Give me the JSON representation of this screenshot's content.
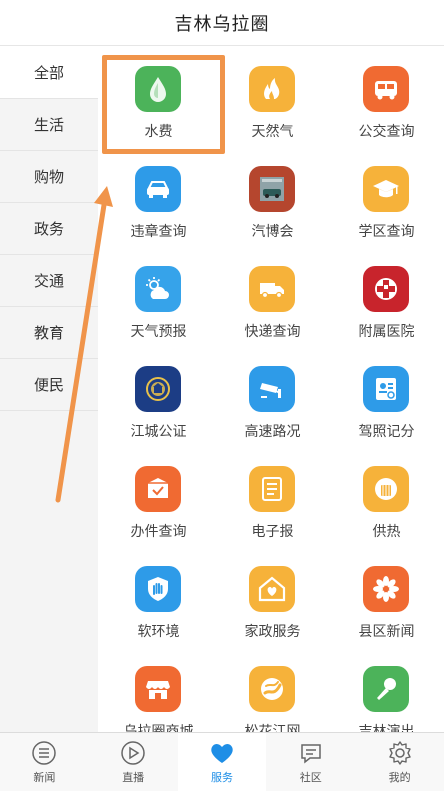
{
  "header": {
    "title": "吉林乌拉圈"
  },
  "sidebar": {
    "items": [
      {
        "label": "全部",
        "active": true
      },
      {
        "label": "生活"
      },
      {
        "label": "购物"
      },
      {
        "label": "政务"
      },
      {
        "label": "交通"
      },
      {
        "label": "教育"
      },
      {
        "label": "便民"
      }
    ]
  },
  "services": [
    {
      "label": "水费",
      "icon": "water-drop-icon",
      "color": "#4cb35a"
    },
    {
      "label": "天然气",
      "icon": "flame-icon",
      "color": "#f6b23a"
    },
    {
      "label": "公交查询",
      "icon": "bus-icon",
      "color": "#f06a32"
    },
    {
      "label": "违章查询",
      "icon": "car-icon",
      "color": "#2e9be8"
    },
    {
      "label": "汽博会",
      "icon": "garage-car-icon",
      "color": "#b5462e"
    },
    {
      "label": "学区查询",
      "icon": "graduation-cap-icon",
      "color": "#f6b23a"
    },
    {
      "label": "天气预报",
      "icon": "weather-icon",
      "color": "#36a3ea"
    },
    {
      "label": "快递查询",
      "icon": "delivery-truck-icon",
      "color": "#f6b23a"
    },
    {
      "label": "附属医院",
      "icon": "hospital-cross-icon",
      "color": "#c8242c"
    },
    {
      "label": "江城公证",
      "icon": "emblem-icon",
      "color": "#1c3d85"
    },
    {
      "label": "高速路况",
      "icon": "camera-icon",
      "color": "#2e9be8"
    },
    {
      "label": "驾照记分",
      "icon": "license-card-icon",
      "color": "#2e9be8"
    },
    {
      "label": "办件查询",
      "icon": "checklist-box-icon",
      "color": "#f06a32"
    },
    {
      "label": "电子报",
      "icon": "newspaper-icon",
      "color": "#f6b23a"
    },
    {
      "label": "供热",
      "icon": "radiator-icon",
      "color": "#f6b23a"
    },
    {
      "label": "软环境",
      "icon": "hand-shield-icon",
      "color": "#2e9be8"
    },
    {
      "label": "家政服务",
      "icon": "house-heart-icon",
      "color": "#f6b23a"
    },
    {
      "label": "县区新闻",
      "icon": "flower-icon",
      "color": "#f06a32"
    },
    {
      "label": "乌拉圈商城",
      "icon": "shop-icon",
      "color": "#f06a32"
    },
    {
      "label": "松花江网",
      "icon": "river-logo-icon",
      "color": "#f6b23a"
    },
    {
      "label": "吉林演出",
      "icon": "microphone-icon",
      "color": "#4cb35a"
    }
  ],
  "tabbar": {
    "items": [
      {
        "label": "新闻",
        "icon": "menu-lines-icon"
      },
      {
        "label": "直播",
        "icon": "play-circle-icon"
      },
      {
        "label": "服务",
        "icon": "heart-icon",
        "active": true
      },
      {
        "label": "社区",
        "icon": "chat-bubble-icon"
      },
      {
        "label": "我的",
        "icon": "gear-icon"
      }
    ]
  },
  "colors": {
    "annotation": "#f0944a",
    "tab_active": "#1e8ee6"
  }
}
